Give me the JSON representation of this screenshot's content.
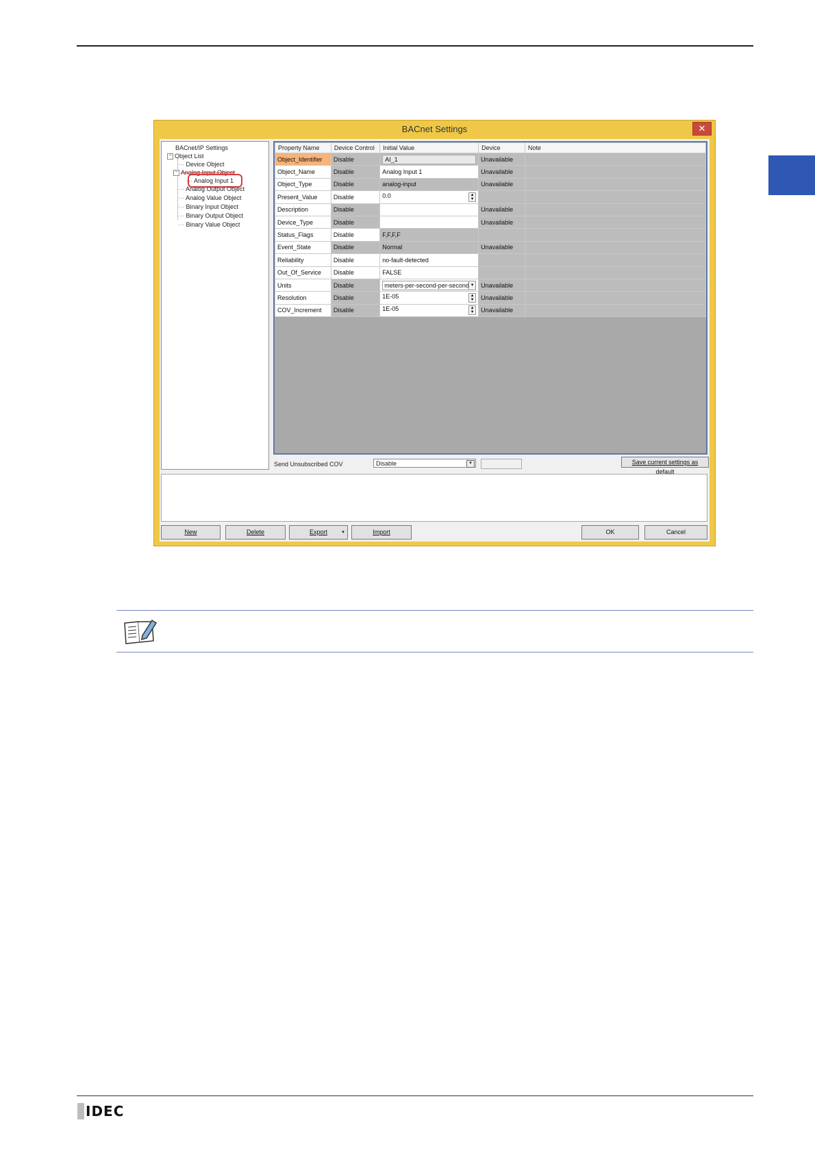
{
  "window": {
    "title": "BACnet Settings",
    "close": "✕"
  },
  "tree": {
    "root": "BACnet/IP Settings",
    "object_list": "Object List",
    "items": {
      "device": "Device Object",
      "analog_input": "Analog Input Object",
      "analog_input_1": "Analog Input 1",
      "analog_output": "Analog Output Object",
      "analog_value": "Analog Value Object",
      "binary_input": "Binary Input Object",
      "binary_output": "Binary Output Object",
      "binary_value": "Binary Value Object"
    },
    "expander": "−"
  },
  "grid": {
    "headers": [
      "Property Name",
      "Device Control",
      "Initial Value",
      "Device",
      "Note"
    ],
    "rows": [
      {
        "name": "Object_Identifier",
        "control": "Disable",
        "initial": "AI_1",
        "device": "Unavailable"
      },
      {
        "name": "Object_Name",
        "control": "Disable",
        "initial": "Analog Input 1",
        "device": "Unavailable"
      },
      {
        "name": "Object_Type",
        "control": "Disable",
        "initial": "analog-input",
        "device": "Unavailable"
      },
      {
        "name": "Present_Value",
        "control": "Disable",
        "initial": "0.0",
        "device": ""
      },
      {
        "name": "Description",
        "control": "Disable",
        "initial": "",
        "device": "Unavailable"
      },
      {
        "name": "Device_Type",
        "control": "Disable",
        "initial": "",
        "device": "Unavailable"
      },
      {
        "name": "Status_Flags",
        "control": "Disable",
        "initial": "F,F,F,F",
        "device": ""
      },
      {
        "name": "Event_State",
        "control": "Disable",
        "initial": "Normal",
        "device": "Unavailable"
      },
      {
        "name": "Reliability",
        "control": "Disable",
        "initial": "no-fault-detected",
        "device": ""
      },
      {
        "name": "Out_Of_Service",
        "control": "Disable",
        "initial": "FALSE",
        "device": ""
      },
      {
        "name": "Units",
        "control": "Disable",
        "initial": "meters-per-second-per-second",
        "device": "Unavailable"
      },
      {
        "name": "Resolution",
        "control": "Disable",
        "initial": "1E-05",
        "device": "Unavailable"
      },
      {
        "name": "COV_Increment",
        "control": "Disable",
        "initial": "1E-05",
        "device": "Unavailable"
      }
    ]
  },
  "cov": {
    "label": "Send Unsubscribed COV",
    "value": "Disable"
  },
  "save_default_label": "Save current settings as default",
  "buttons": {
    "new": "New",
    "delete": "Delete",
    "export": "Export",
    "import": "Import",
    "ok": "OK",
    "cancel": "Cancel"
  },
  "footer": {
    "logo": "IDEC"
  },
  "colors": {
    "accent_tab": "#2e58b4",
    "window_frame": "#f0c848",
    "highlight_ring": "#d83a3a",
    "active_cell": "#f7b37a"
  }
}
